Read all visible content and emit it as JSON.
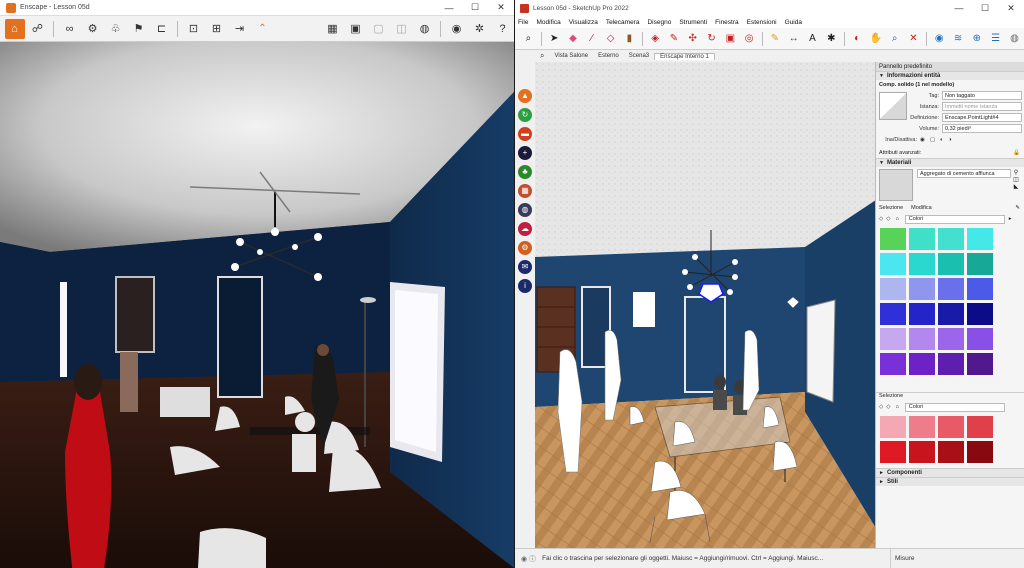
{
  "enscape": {
    "title": "Enscape - Lesson 05d",
    "window_controls": [
      "—",
      "☐",
      "✕"
    ],
    "toolbar_icons": [
      "home-icon",
      "walk-icon",
      "binoculars-icon",
      "settings-icon",
      "tree-icon",
      "flag-icon",
      "bracket-icon",
      "screenshot-icon",
      "clip-icon",
      "export-icon",
      "map-icon",
      "video-icon",
      "box-icon",
      "vr-icon",
      "wireframe-icon",
      "eye-icon",
      "gear-icon",
      "help-icon"
    ]
  },
  "sketchup": {
    "title": "Lesson 05d - SketchUp Pro 2022",
    "window_controls": [
      "—",
      "☐",
      "✕"
    ],
    "menu": [
      "File",
      "Modifica",
      "Visualizza",
      "Telecamera",
      "Disegno",
      "Strumenti",
      "Finestra",
      "Estensioni",
      "Guida"
    ],
    "scenes": [
      "Vista Salone",
      "Esterno",
      "Scena3",
      "Enscape Interno 1"
    ],
    "active_scene": "Enscape Interno 1",
    "status_text": "Fai clic o trascina per selezionare gli oggetti. Maiusc = Aggiungi/rimuovi. Ctrl = Aggiungi. Maiusc...",
    "measure_label": "Misure"
  },
  "tray": {
    "title": "Pannello predefinito",
    "entity_info": {
      "header": "Informazioni entità",
      "selection": "Comp. solido (1 nel modello)",
      "tag_label": "Tag:",
      "tag_value": "Non taggato",
      "instance_label": "Istanza:",
      "instance_placeholder": "Immetti nome istanza",
      "definition_label": "Definizione:",
      "definition_value": "Enscape.PointLight#4",
      "volume_label": "Volume:",
      "volume_value": "0,32 piedi³",
      "toggles_label": "Ina/Disattiva:",
      "advanced_label": "Attributi avanzati:"
    },
    "materials": {
      "header": "Materiali",
      "current": "Aggregato di cemento affiunca",
      "tab_select": "Selezione",
      "tab_edit": "Modifica",
      "library": "Colori",
      "swatches": [
        "#57d35a",
        "#3ee0c8",
        "#43e0d0",
        "#45e8e8",
        "#4ce6f0",
        "#2ad8d0",
        "#1bbfb0",
        "#17a898",
        "#aeb6f0",
        "#8e96ee",
        "#6a70ec",
        "#4c5ae8",
        "#3030d8",
        "#2424c8",
        "#1a1aa8",
        "#0c0c88",
        "#c6a8f0",
        "#b288ee",
        "#9c66ea",
        "#8850e6",
        "#7a30d8",
        "#6c22c4",
        "#5e1eb0",
        "#52188e"
      ],
      "selection_label": "Selezione",
      "secondary_library": "Colori",
      "secondary_swatches": [
        "#f4a8b4",
        "#ef7c8a",
        "#e85a68",
        "#e0404a",
        "#e01a24",
        "#c8141c",
        "#a80f16",
        "#880a10"
      ]
    },
    "components_header": "Componenti",
    "skill_header": "Stili"
  },
  "colors": {
    "enscape_accent": "#e2701f",
    "wall_blue": "#123a6a",
    "floor_wood": "#c8935a"
  }
}
